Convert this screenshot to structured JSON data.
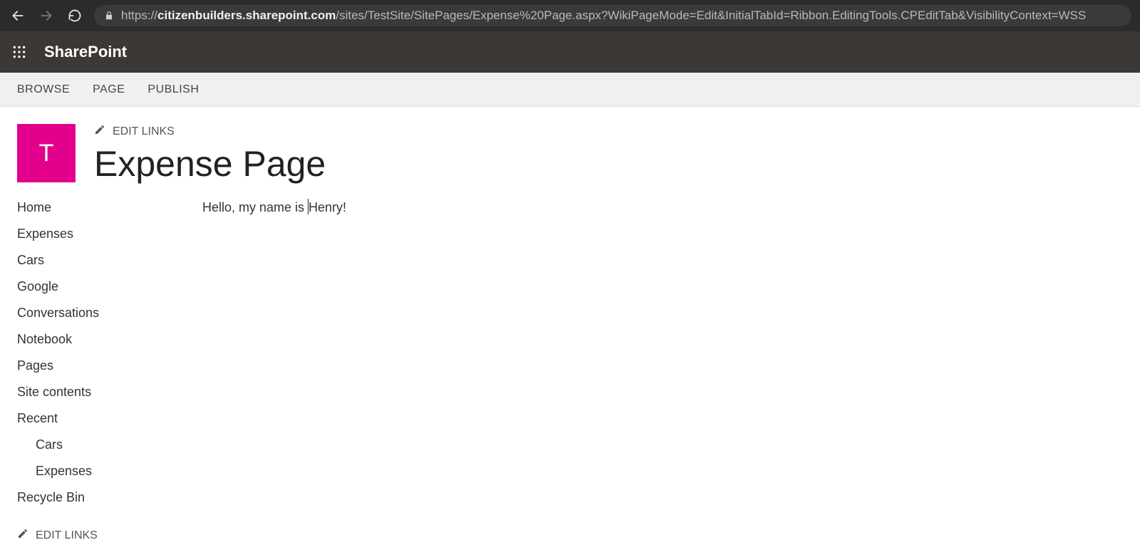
{
  "browser": {
    "url_prefix": "https://",
    "url_host": "citizenbuilders.sharepoint.com",
    "url_path": "/sites/TestSite/SitePages/Expense%20Page.aspx?WikiPageMode=Edit&InitialTabId=Ribbon.EditingTools.CPEditTab&VisibilityContext=WSS"
  },
  "suite": {
    "brand": "SharePoint"
  },
  "ribbon": {
    "tabs": [
      "BROWSE",
      "PAGE",
      "PUBLISH"
    ]
  },
  "header": {
    "logo_letter": "T",
    "edit_links_label": "EDIT LINKS",
    "page_title": "Expense Page"
  },
  "nav": {
    "items": [
      {
        "label": "Home",
        "sub": false
      },
      {
        "label": "Expenses",
        "sub": false
      },
      {
        "label": "Cars",
        "sub": false
      },
      {
        "label": "Google",
        "sub": false
      },
      {
        "label": "Conversations",
        "sub": false
      },
      {
        "label": "Notebook",
        "sub": false
      },
      {
        "label": "Pages",
        "sub": false
      },
      {
        "label": "Site contents",
        "sub": false
      },
      {
        "label": "Recent",
        "sub": false
      },
      {
        "label": "Cars",
        "sub": true
      },
      {
        "label": "Expenses",
        "sub": true
      },
      {
        "label": "Recycle Bin",
        "sub": false
      }
    ],
    "edit_links_label": "EDIT LINKS"
  },
  "content": {
    "text_before_caret": "Hello, my name is ",
    "text_after_caret": "Henry!"
  }
}
